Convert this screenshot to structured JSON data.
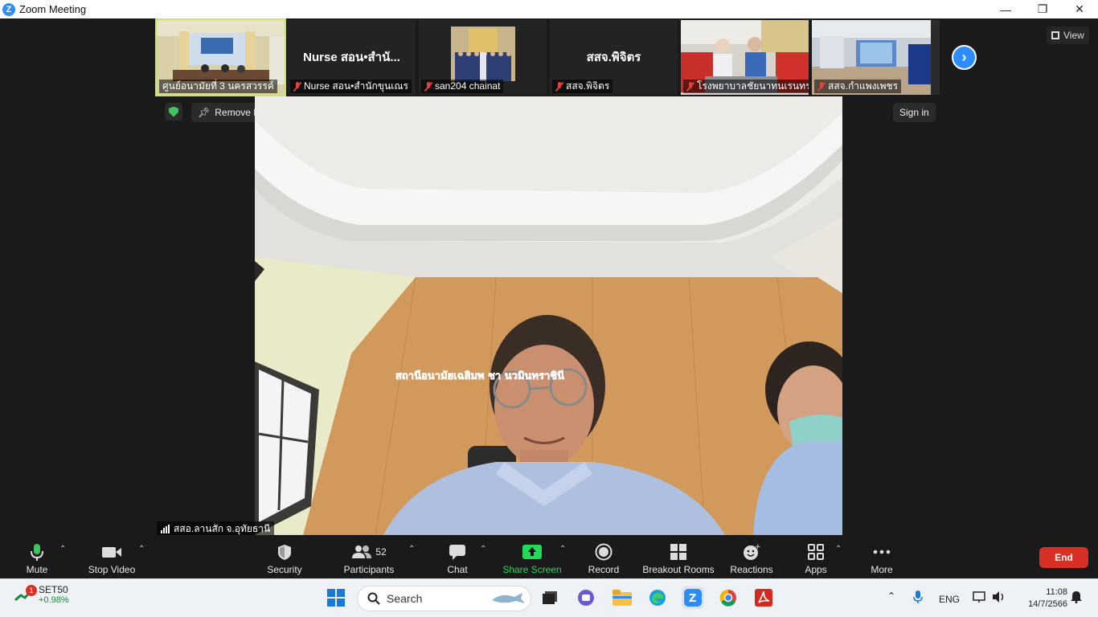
{
  "window": {
    "title": "Zoom Meeting",
    "controls": [
      "minimize",
      "restore",
      "close"
    ]
  },
  "thumbnails": [
    {
      "name": "ศูนย์อนามัยที่ 3 นครสวรรค์",
      "type": "video",
      "muted": false,
      "pinned": true
    },
    {
      "name": "Nurse สอน•สำนักขุนเณร",
      "display_name": "Nurse สอน•สำนั...",
      "type": "name",
      "muted": true
    },
    {
      "name": "san204 chainat",
      "type": "video",
      "muted": true
    },
    {
      "name": "สสจ.พิจิตร",
      "display_name": "สสจ.พิจิตร",
      "type": "name",
      "muted": true
    },
    {
      "name": "โรงพยาบาลชัยนาทนเรนทร",
      "type": "video",
      "muted": true
    },
    {
      "name": "สสจ.กำแพงเพชร",
      "type": "video",
      "muted": true
    }
  ],
  "view_label": "View",
  "remove_pin_label": "Remove Pin",
  "sign_in_label": "Sign in",
  "main_video": {
    "speaker_name": "สสอ.ลานสัก จ.อุทัยธานี",
    "wall_sign": "สถานีอนามัยเฉลิมพ      ชา  นวมินทราชินี"
  },
  "toolbar": {
    "mute": "Mute",
    "stop_video": "Stop Video",
    "security": "Security",
    "participants": "Participants",
    "participants_count": "52",
    "chat": "Chat",
    "share_screen": "Share Screen",
    "record": "Record",
    "breakout_rooms": "Breakout Rooms",
    "reactions": "Reactions",
    "apps": "Apps",
    "more": "More",
    "end": "End"
  },
  "colors": {
    "zoom_blue": "#2d8cff",
    "share_green": "#23d959",
    "end_red": "#d93025",
    "pin_outline": "#c7e36a"
  },
  "taskbar": {
    "stock_name": "SET50",
    "stock_change": "+0.98%",
    "stock_badge": "1",
    "search_placeholder": "Search",
    "language": "ENG",
    "time": "11:08",
    "date": "14/7/2566"
  }
}
